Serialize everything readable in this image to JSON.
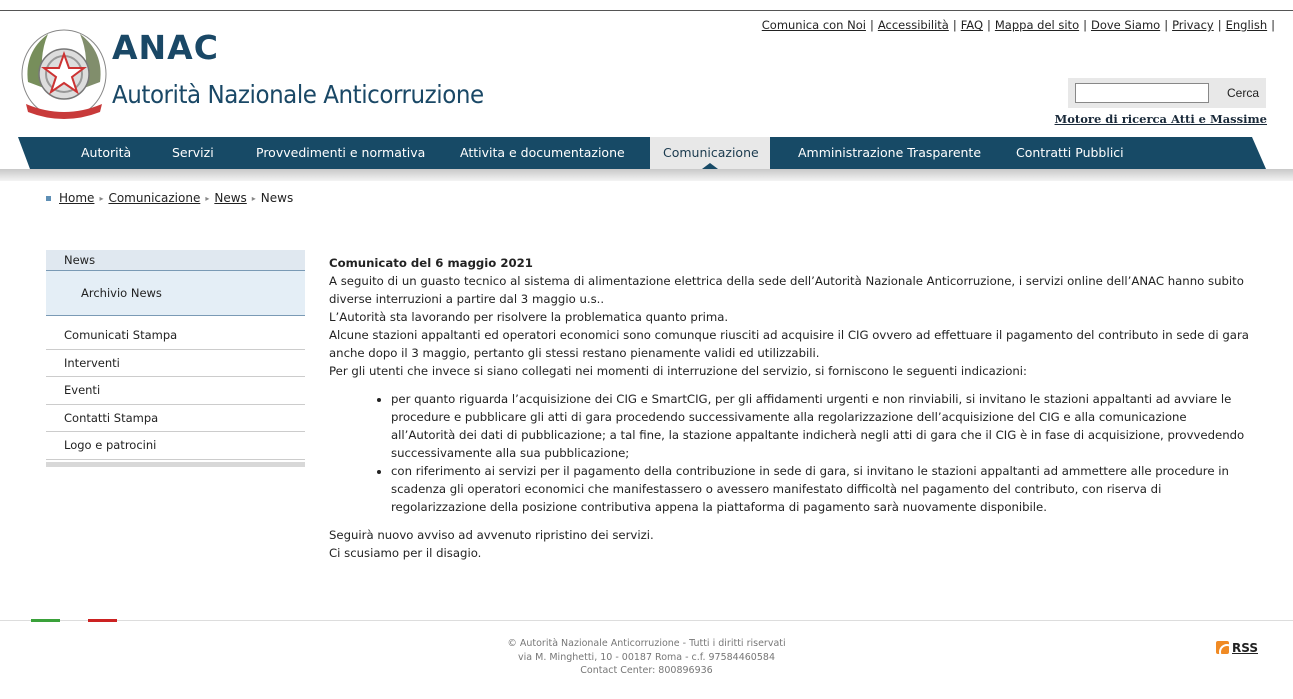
{
  "header": {
    "top_links": [
      "Comunica con Noi",
      "Accessibilità",
      "FAQ",
      "Mappa del sito",
      "Dove Siamo",
      "Privacy",
      "English"
    ],
    "separator": "|",
    "logo_short": "ANAC",
    "logo_full": "Autorità Nazionale Anticorruzione",
    "search_value": "",
    "search_button": "Cerca",
    "search_link": "Motore di ricerca Atti e Massime"
  },
  "nav": {
    "items": [
      "Autorità",
      "Servizi",
      "Provvedimenti e normativa",
      "Attivita e documentazione",
      "Comunicazione",
      "Amministrazione Trasparente",
      "Contratti Pubblici"
    ],
    "active": "Comunicazione"
  },
  "breadcrumb": {
    "items": [
      "Home",
      "Comunicazione",
      "News",
      "News"
    ]
  },
  "sidebar": {
    "head": "News",
    "sub": "Archivio News",
    "items": [
      "Comunicati Stampa",
      "Interventi",
      "Eventi",
      "Contatti Stampa",
      "Logo e patrocini"
    ]
  },
  "article": {
    "title": "Comunicato del 6 maggio 2021",
    "p1": "A seguito di un guasto tecnico al sistema di alimentazione elettrica della sede dell’Autorità Nazionale Anticorruzione, i servizi online dell’ANAC hanno subito diverse interruzioni a partire dal 3 maggio u.s..",
    "p2": "L’Autorità sta lavorando per risolvere la problematica quanto prima.",
    "p3": "Alcune stazioni appaltanti ed operatori economici sono comunque riusciti ad acquisire il CIG ovvero ad effettuare il pagamento del contributo in sede di gara anche dopo il 3 maggio, pertanto gli stessi restano pienamente validi ed utilizzabili.",
    "p4": "Per gli utenti che invece si siano collegati nei momenti di interruzione del servizio, si forniscono le seguenti indicazioni:",
    "bullets": [
      "per quanto riguarda l’acquisizione dei CIG e SmartCIG, per gli affidamenti urgenti e non rinviabili, si invitano le stazioni appaltanti ad avviare le procedure e pubblicare gli atti di gara procedendo successivamente alla regolarizzazione dell’acquisizione del CIG e alla comunicazione all’Autorità dei dati di pubblicazione; a tal fine, la stazione appaltante indicherà negli atti di gara che il CIG è in fase di acquisizione, provvedendo successivamente alla sua pubblicazione;",
      "con riferimento ai servizi per il pagamento della contribuzione in sede di gara, si invitano le stazioni appaltanti ad ammettere alle procedure in scadenza gli operatori economici che manifestassero o avessero manifestato difficoltà nel pagamento del contributo, con riserva di regolarizzazione della posizione contributiva appena la piattaforma di pagamento sarà nuovamente disponibile."
    ],
    "p5": "Seguirà nuovo avviso ad avvenuto ripristino dei servizi.",
    "p6": "Ci scusiamo per il disagio."
  },
  "footer": {
    "line1": "© Autorità Nazionale Anticorruzione - Tutti i diritti riservati",
    "line2": "via M. Minghetti, 10 - 00187 Roma - c.f. 97584460584",
    "line3": "Contact Center: 800896936",
    "rss": "RSS"
  },
  "colors": {
    "nav_bg": "#174a66",
    "nav_active_bg": "#e8e8e8",
    "logo_text": "#1a4866",
    "flag_green": "#3aa13a",
    "flag_red": "#cc2222",
    "rss_orange": "#f08a24"
  }
}
